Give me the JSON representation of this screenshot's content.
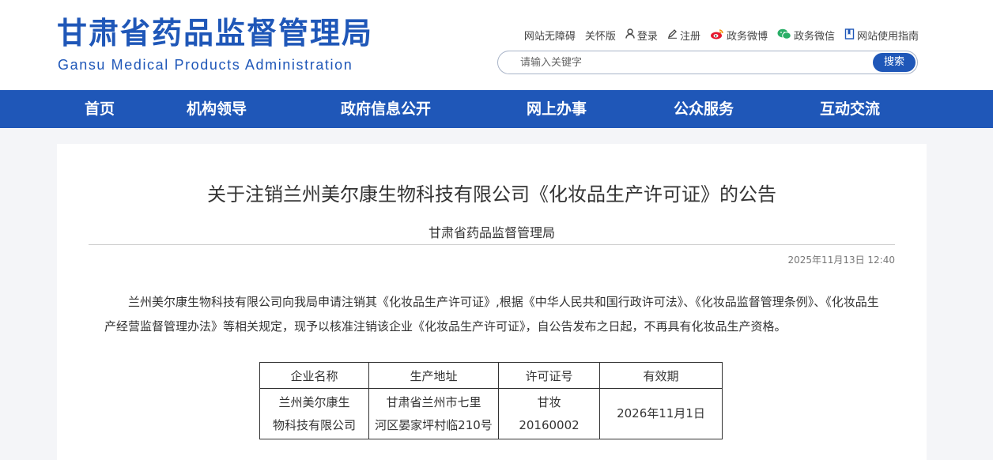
{
  "header": {
    "logo_cn": "甘肃省药品监督管理局",
    "logo_en": "Gansu Medical Products Administration",
    "links": {
      "accessibility": "网站无障碍",
      "care": "关怀版",
      "login": "登录",
      "register": "注册",
      "weibo": "政务微博",
      "wechat": "政务微信",
      "guide": "网站使用指南"
    },
    "search": {
      "placeholder": "请输入关键字",
      "button": "搜索"
    }
  },
  "nav": [
    "首页",
    "机构领导",
    "政府信息公开",
    "网上办事",
    "公众服务",
    "互动交流"
  ],
  "article": {
    "title": "关于注销兰州美尔康生物科技有限公司《化妆品生产许可证》的公告",
    "source": "甘肃省药品监督管理局",
    "date": "2025年11月13日 12:40",
    "body": "兰州美尔康生物科技有限公司向我局申请注销其《化妆品生产许可证》,根据《中华人民共和国行政许可法》、《化妆品监督管理条例》、《化妆品生产经营监督管理办法》等相关规定，现予以核准注销该企业《化妆品生产许可证》，自公告发布之日起，不再具有化妆品生产资格。",
    "table": {
      "headers": [
        "企业名称",
        "生产地址",
        "许可证号",
        "有效期"
      ],
      "row": {
        "company_l1": "兰州美尔康生",
        "company_l2": "物科技有限公司",
        "address_l1": "甘肃省兰州市七里",
        "address_l2": "河区晏家坪村临210号",
        "license_l1": "甘妆",
        "license_l2": "20160002",
        "validity": "2026年11月1日"
      }
    }
  }
}
